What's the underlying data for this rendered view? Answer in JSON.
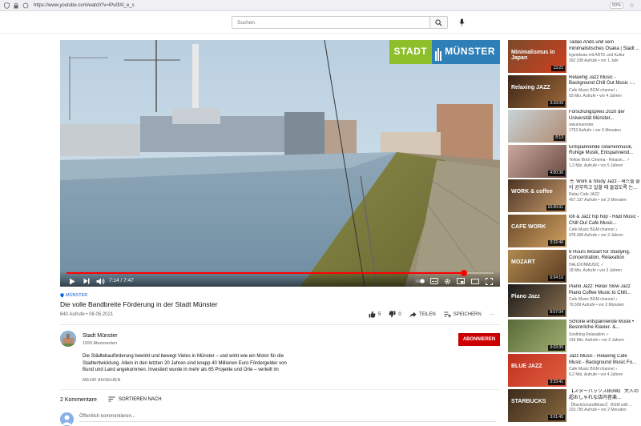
{
  "browser": {
    "url": "https://www.youtube.com/watch?v=lPu0lXl_e_s",
    "zoom": "50%"
  },
  "header": {
    "search_placeholder": "Suchen"
  },
  "video": {
    "logo_left": "STADT",
    "logo_right": "MÜNSTER",
    "time": "7:14 / 7:47",
    "progress": 0.93,
    "hashtag": "MÜNSTER",
    "title": "Die volle Bandbreite Förderung in der Stadt Münster",
    "meta": "640 Aufrufe • 06.05.2021",
    "likes": "5",
    "dislikes": "0",
    "share_label": "TEILEN",
    "save_label": "SPEICHERN",
    "more": "···"
  },
  "channel": {
    "name": "Stadt Münster",
    "subs": "1550 Abonnenten",
    "subscribe_label": "ABONNIEREN",
    "description": "Die Städtebauförderung bewirkt und bewegt Vieles in Münster – und wirkt wie ein Motor für die Stadtentwicklung. Allein in den letzten 20 Jahren sind knapp 40 Millionen Euro Fördergelder von Bund und Land angekommen. Investiert wurde in mehr als 65 Projekte und Orte – verteilt im",
    "more_label": "MEHR ANSEHEN"
  },
  "comments": {
    "count": "2 Kommentare",
    "sort_label": "SORTIEREN NACH",
    "placeholder": "Öffentlich kommentieren..."
  },
  "recommendations": [
    {
      "title": "Tadao Andō und sein minimalistisches Osaka | Stadt ...",
      "channel": "Irgendwas mit ARTE und Kultur",
      "views": "392.338 Aufrufe • vor 1 Jahr",
      "duration": "13:22",
      "thumb_text": "Minimalismus in Japan",
      "color": "#7a4a2a",
      "color2": "#d04020"
    },
    {
      "title": "Relaxing Jazz Music - Background Chill Out Music -...",
      "channel": "Cafe Music BGM channel ♪",
      "views": "83 Mio. Aufrufe • vor 4 Jahren",
      "duration": "3:33:09",
      "thumb_text": "Relaxing JAZZ",
      "color": "#3a2418",
      "color2": "#a06a3a"
    },
    {
      "title": "Forschungspreis 2020 der Universität Münster...",
      "channel": "wwumuenster",
      "views": "1752 Aufrufe • vor 6 Monaten",
      "duration": "8:13",
      "thumb_text": "",
      "color": "#c8d4d8",
      "color2": "#b08a70"
    },
    {
      "title": "Entspannende Gitarrenmusik, Ruhige Musik, Entspannend...",
      "channel": "Yellow Brick Cinema - Relaxin... ✓",
      "views": "1,3 Mio. Aufrufe • vor 5 Jahren",
      "duration": "4:00:30",
      "thumb_text": "",
      "color": "#caa8a0",
      "color2": "#6a4a40"
    },
    {
      "title": "☕ Work & Study Jazz - 재즈를 들어 공부하고 일할 때 들었도록 는...",
      "channel": "Relax Cafe JAZZ",
      "views": "457.137 Aufrufe • vor 2 Monaten",
      "duration": "10:00:01",
      "thumb_text": "WORK & coffee",
      "color": "#4a3424",
      "color2": "#c89a6a"
    },
    {
      "title": "lofi & Jazz hip hop - R&B Music - Chill Out Cafe Music...",
      "channel": "Cafe Music BGM channel ♪",
      "views": "978.368 Aufrufe • vor 3 Jahren",
      "duration": "3:32:46",
      "thumb_text": "CAFE WORK",
      "color": "#6a4a2a",
      "color2": "#d0a060"
    },
    {
      "title": "6 Hours Mozart for Studying, Concentration, Relaxation",
      "channel": "HALIDONMUSIC ✓",
      "views": "18 Mio. Aufrufe • vor 3 Jahren",
      "duration": "6:04:16",
      "thumb_text": "MOZART",
      "color": "#b08a50",
      "color2": "#5a3a20"
    },
    {
      "title": "Piano Jazz: Relax Slow Jazz Piano Coffee Music to Chill...",
      "channel": "Cafe Music BGM channel ♪",
      "views": "76.599 Aufrufe • vor 2 Monaten",
      "duration": "8:07:04",
      "thumb_text": "Piano Jazz",
      "color": "#1a1a1a",
      "color2": "#8a7050"
    },
    {
      "title": "Schöne entspannende Musik • Besinnliche Klavier- &...",
      "channel": "Soothing Relaxation ✓",
      "views": "139 Mio. Aufrufe • vor 3 Jahren",
      "duration": "3:03:39",
      "thumb_text": "",
      "color": "#5a6a3a",
      "color2": "#a0b070"
    },
    {
      "title": "Jazz Music - Relaxing Cafe Music - Background Music Fo...",
      "channel": "Cafe Music BGM channel ♪",
      "views": "6,2 Mio. Aufrufe • vor 4 Jahren",
      "duration": "3:33:41",
      "thumb_text": "BLUE JAZZ",
      "color": "#c03020",
      "color2": "#e06040"
    },
    {
      "title": "【スターバックスBGM】 大人の超おしゃれな店内音楽...",
      "channel": "【BackGroundMusic】 BGM with ...",
      "views": "103.795 Aufrufe • vor 2 Monaten",
      "duration": "3:01:45",
      "thumb_text": "STARBUCKS",
      "color": "#3a2a1a",
      "color2": "#8a6a40"
    }
  ],
  "colors": {
    "accent": "#cc0000",
    "link": "#065fd4",
    "progress": "#ff0000",
    "logo_green": "#8dbf2a",
    "logo_blue": "#2e7fb8"
  }
}
